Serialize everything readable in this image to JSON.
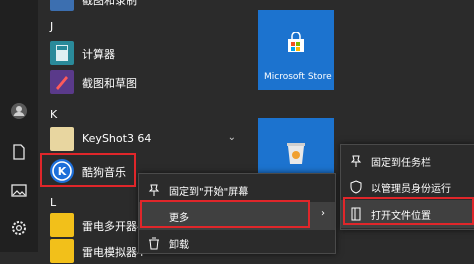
{
  "left_icons": [
    "user-icon",
    "document-icon",
    "pictures-icon",
    "settings-icon"
  ],
  "app_list": {
    "top_cut_label": "截图和录制",
    "group_j": "J",
    "app_calculator": "计算器",
    "app_snip": "截图和草图",
    "group_k": "K",
    "app_keyshot": "KeyShot3 64",
    "app_kugou": "酷狗音乐",
    "group_l": "L",
    "app_leidian_multi": "雷电多开器4",
    "app_leidian_sim": "雷电模拟器4"
  },
  "tiles": {
    "store_label": "Microsoft Store"
  },
  "context_menu": {
    "pin_start": "固定到\"开始\"屏幕",
    "more": "更多",
    "uninstall": "卸载"
  },
  "submenu": {
    "pin_taskbar": "固定到任务栏",
    "run_admin": "以管理员身份运行",
    "open_location": "打开文件位置"
  },
  "colors": {
    "accent": "#1c73cf",
    "highlight_box": "#e0262a",
    "kugou_blue": "#1e6fd9"
  }
}
